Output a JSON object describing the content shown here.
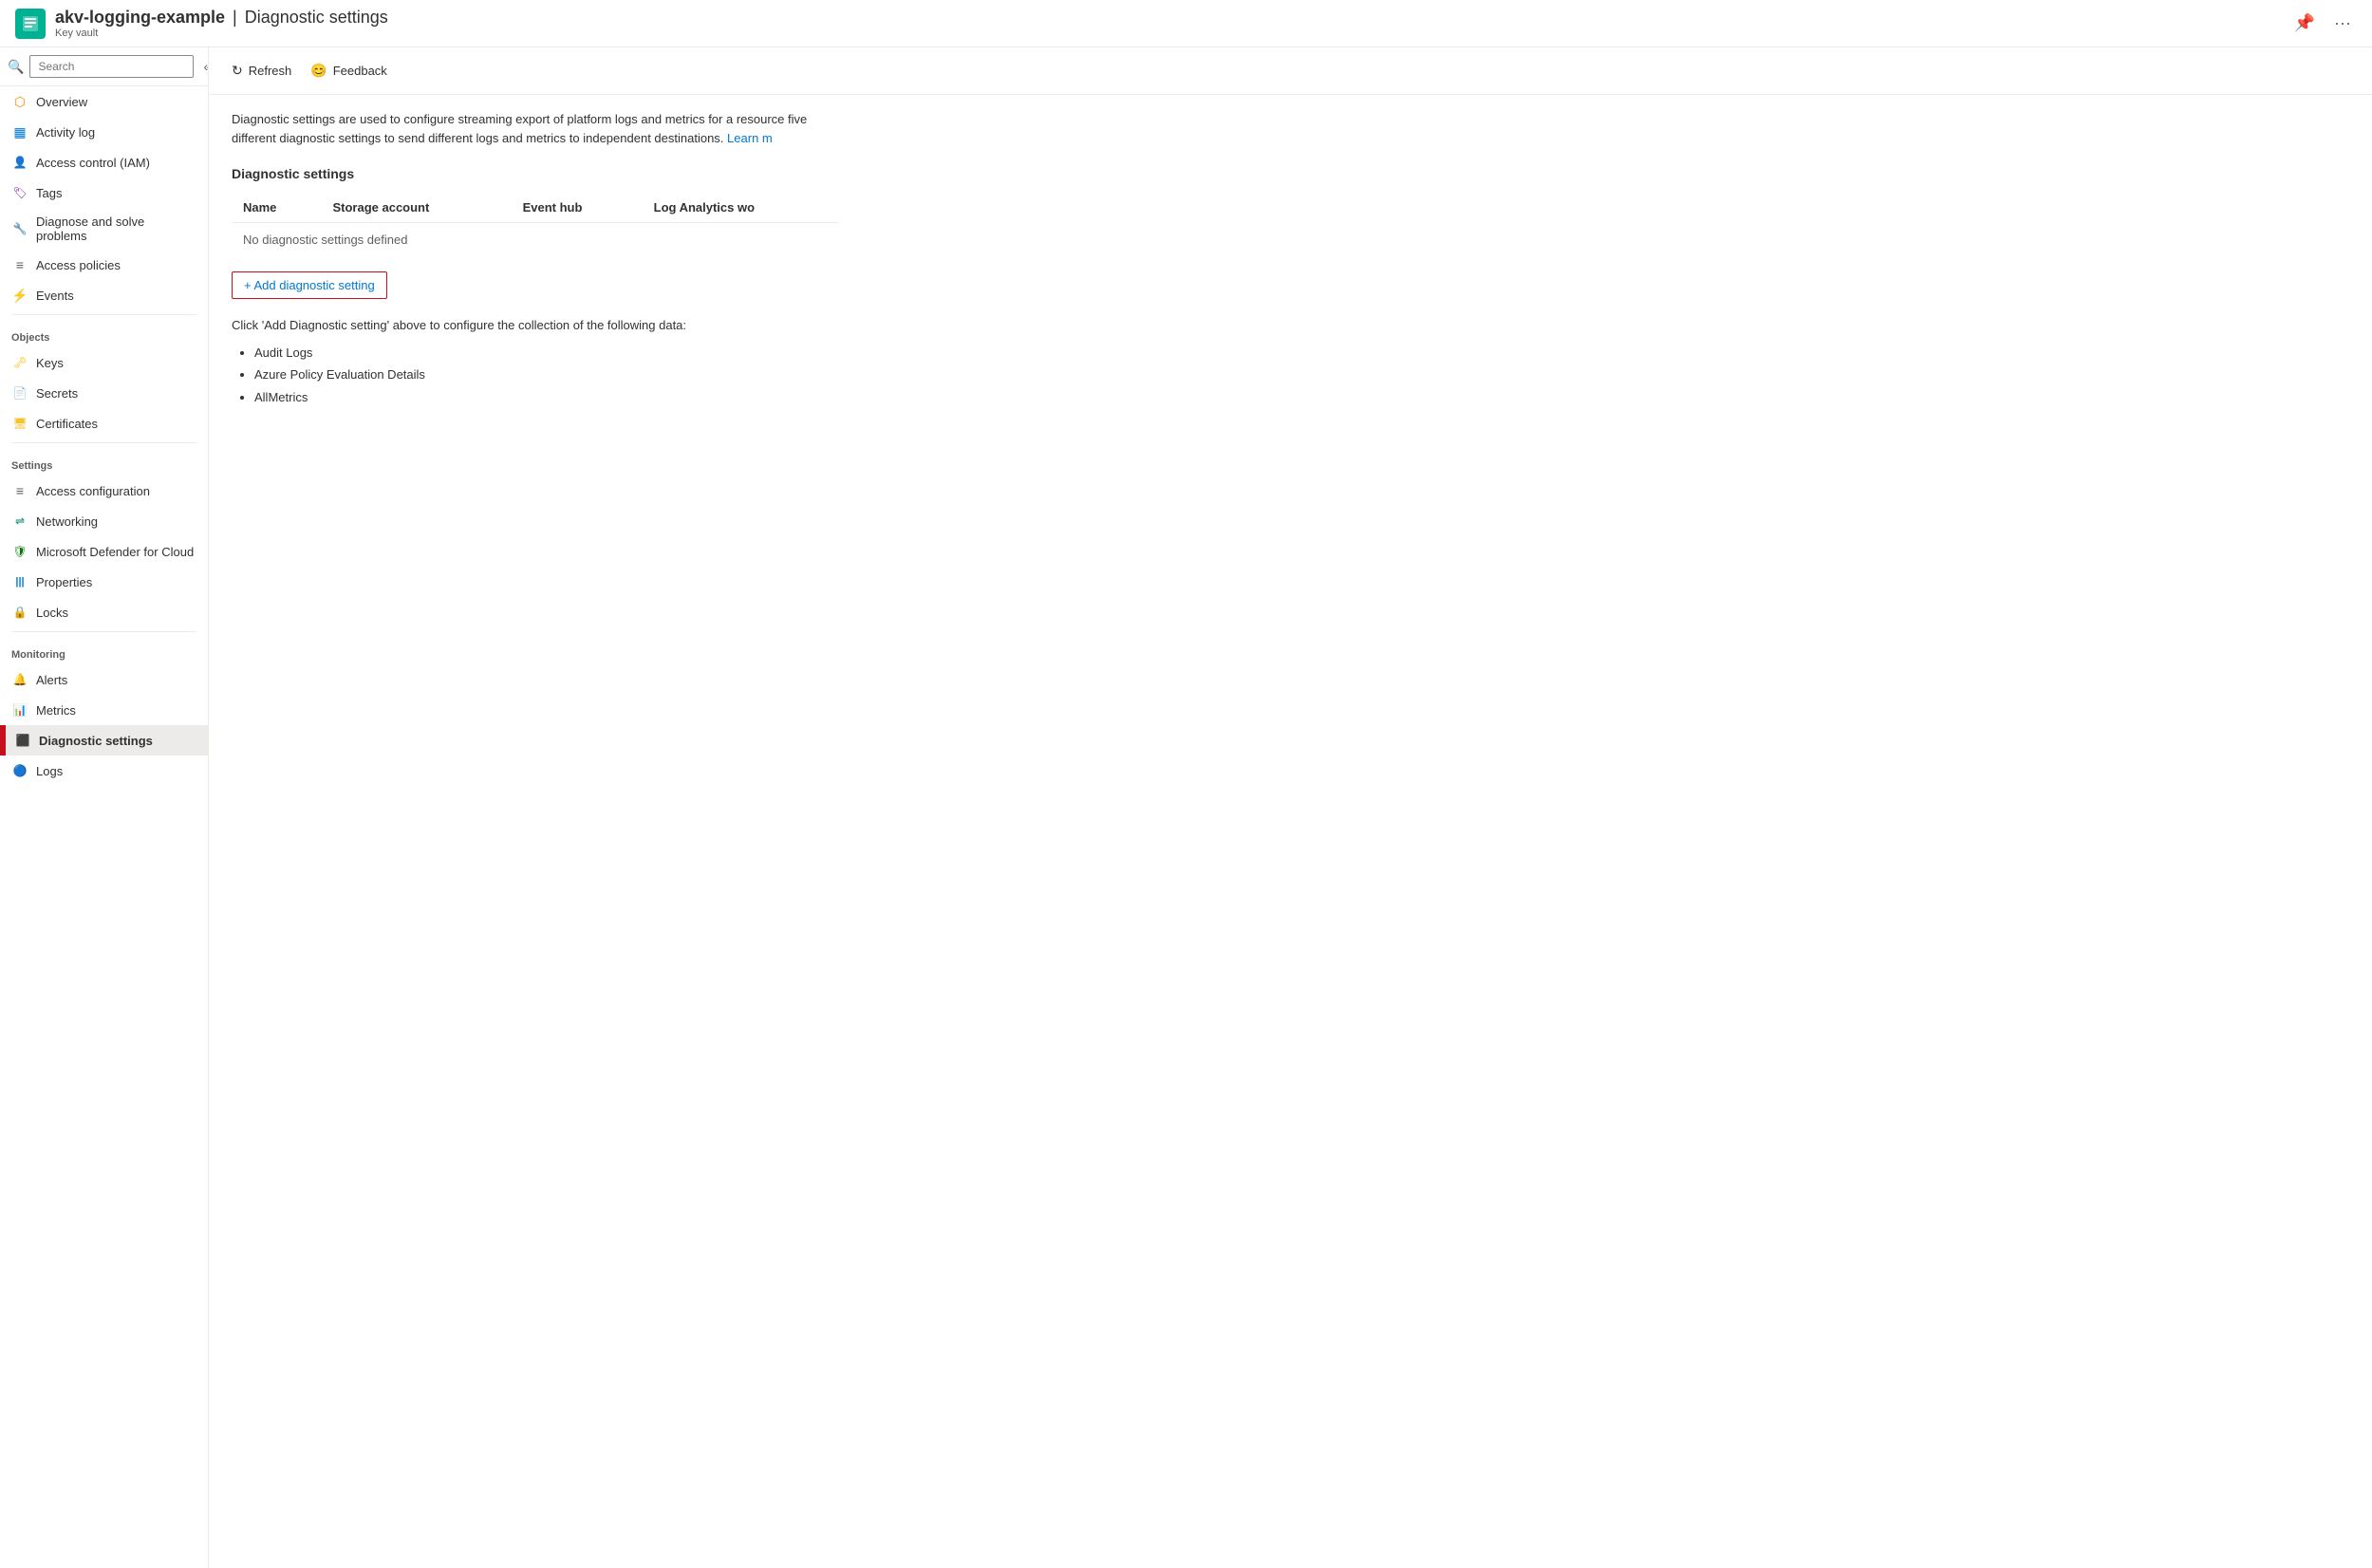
{
  "header": {
    "resource_name": "akv-logging-example",
    "separator": "|",
    "page_title": "Diagnostic settings",
    "subtitle": "Key vault",
    "pin_label": "Pin",
    "more_label": "More"
  },
  "sidebar": {
    "search_placeholder": "Search",
    "collapse_label": "Collapse",
    "items": [
      {
        "id": "overview",
        "label": "Overview",
        "icon": "⬡",
        "icon_color": "#ff8c00"
      },
      {
        "id": "activity-log",
        "label": "Activity log",
        "icon": "▦",
        "icon_color": "#0078d4"
      },
      {
        "id": "iam",
        "label": "Access control (IAM)",
        "icon": "👤",
        "icon_color": "#605e5c"
      },
      {
        "id": "tags",
        "label": "Tags",
        "icon": "🏷",
        "icon_color": "#7719aa"
      },
      {
        "id": "diagnose",
        "label": "Diagnose and solve problems",
        "icon": "🔧",
        "icon_color": "#323130"
      },
      {
        "id": "access-policies",
        "label": "Access policies",
        "icon": "≡",
        "icon_color": "#605e5c"
      },
      {
        "id": "events",
        "label": "Events",
        "icon": "⚡",
        "icon_color": "#f4c430"
      }
    ],
    "sections": [
      {
        "label": "Objects",
        "items": [
          {
            "id": "keys",
            "label": "Keys",
            "icon": "🗝",
            "icon_color": "#f4c430"
          },
          {
            "id": "secrets",
            "label": "Secrets",
            "icon": "📄",
            "icon_color": "#f4c430"
          },
          {
            "id": "certificates",
            "label": "Certificates",
            "icon": "🖥",
            "icon_color": "#f4c430"
          }
        ]
      },
      {
        "label": "Settings",
        "items": [
          {
            "id": "access-config",
            "label": "Access configuration",
            "icon": "≡",
            "icon_color": "#605e5c"
          },
          {
            "id": "networking",
            "label": "Networking",
            "icon": "⇌",
            "icon_color": "#008272"
          },
          {
            "id": "defender",
            "label": "Microsoft Defender for Cloud",
            "icon": "🛡",
            "icon_color": "#007a00"
          },
          {
            "id": "properties",
            "label": "Properties",
            "icon": "|||",
            "icon_color": "#0078d4"
          },
          {
            "id": "locks",
            "label": "Locks",
            "icon": "🔒",
            "icon_color": "#605e5c"
          }
        ]
      },
      {
        "label": "Monitoring",
        "items": [
          {
            "id": "alerts",
            "label": "Alerts",
            "icon": "🔔",
            "icon_color": "#333"
          },
          {
            "id": "metrics",
            "label": "Metrics",
            "icon": "📊",
            "icon_color": "#0078d4"
          },
          {
            "id": "diagnostic-settings",
            "label": "Diagnostic settings",
            "icon": "⬛",
            "icon_color": "#107c10",
            "active": true
          },
          {
            "id": "logs",
            "label": "Logs",
            "icon": "🔵",
            "icon_color": "#0078d4"
          }
        ]
      }
    ]
  },
  "toolbar": {
    "refresh_label": "Refresh",
    "feedback_label": "Feedback"
  },
  "content": {
    "description": "Diagnostic settings are used to configure streaming export of platform logs and metrics for a resource five different diagnostic settings to send different logs and metrics to independent destinations.",
    "learn_more_label": "Learn m",
    "section_title": "Diagnostic settings",
    "table": {
      "columns": [
        "Name",
        "Storage account",
        "Event hub",
        "Log Analytics wo"
      ],
      "empty_message": "No diagnostic settings defined"
    },
    "add_button_label": "+ Add diagnostic setting",
    "collection_instruction": "Click 'Add Diagnostic setting' above to configure the collection of the following data:",
    "data_items": [
      "Audit Logs",
      "Azure Policy Evaluation Details",
      "AllMetrics"
    ]
  }
}
